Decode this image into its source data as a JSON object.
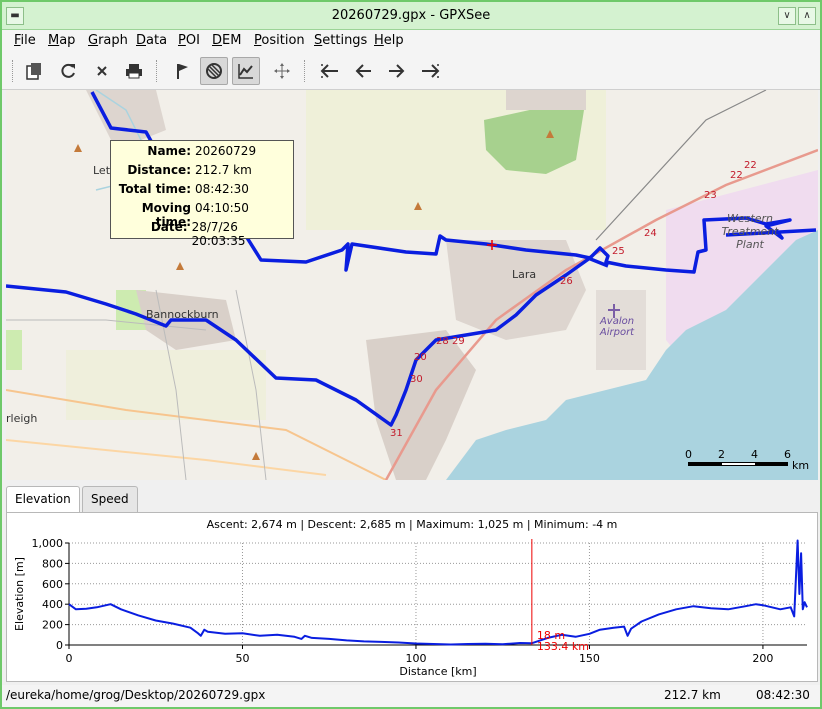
{
  "window": {
    "title": "20260729.gpx - GPXSee"
  },
  "menu": [
    {
      "label": "File",
      "u": "F",
      "rest": "ile"
    },
    {
      "label": "Map",
      "u": "M",
      "rest": "ap"
    },
    {
      "label": "Graph",
      "u": "G",
      "rest": "raph"
    },
    {
      "label": "Data",
      "u": "D",
      "rest": "ata"
    },
    {
      "label": "POI",
      "u": "P",
      "rest": "OI"
    },
    {
      "label": "DEM",
      "u": "D",
      "rest": "EM"
    },
    {
      "label": "Position",
      "u": "P",
      "rest": "osition"
    },
    {
      "label": "Settings",
      "u": "S",
      "rest": "ettings"
    },
    {
      "label": "Help",
      "u": "H",
      "rest": "elp"
    }
  ],
  "toolbar": {
    "icons": [
      "open-icon",
      "reload-icon",
      "close-icon",
      "print-icon",
      "flag-icon",
      "hide-map-icon",
      "graph-icon",
      "pan-icon",
      "first-icon",
      "previous-icon",
      "next-icon",
      "last-icon"
    ],
    "toggled": [
      "hide-map-icon",
      "graph-icon"
    ]
  },
  "track_info": {
    "rows": [
      {
        "key": "Name:",
        "value": "20260729"
      },
      {
        "key": "Distance:",
        "value": "212.7 km"
      },
      {
        "key": "Total time:",
        "value": "08:42:30"
      },
      {
        "key": "Moving time:",
        "value": "04:10:50"
      },
      {
        "key": "Date:",
        "value": "28/7/26 20:03:35"
      }
    ]
  },
  "map": {
    "places": [
      "Lara",
      "Bannockburn",
      "Avalon Airport",
      "Western Treatment Plant",
      "rleigh",
      "Let"
    ],
    "km_markers": [
      "20",
      "22",
      "22",
      "23",
      "24",
      "25",
      "26",
      "28",
      "29",
      "30",
      "31"
    ],
    "scale": {
      "ticks": [
        "0",
        "2",
        "4",
        "6"
      ],
      "unit": "km"
    },
    "colors": {
      "track": "#0a1ee0",
      "water": "#aad3df",
      "park": "#cdebb0",
      "urban": "#d9d0c9",
      "land": "#f2efe9"
    }
  },
  "tabs": [
    {
      "label": "Elevation",
      "active": true
    },
    {
      "label": "Speed",
      "active": false
    }
  ],
  "graph_summary": "Ascent: 2,674 m | Descent: 2,685 m | Maximum: 1,025 m | Minimum: -4 m",
  "chart_data": {
    "type": "line",
    "xlabel": "Distance [km]",
    "ylabel": "Elevation [m]",
    "xlim": [
      0,
      212.7
    ],
    "ylim": [
      0,
      1000
    ],
    "xticks": [
      0,
      50,
      100,
      150,
      200
    ],
    "yticks": [
      0,
      200,
      400,
      600,
      800,
      1000
    ],
    "ytick_labels": [
      "0",
      "200",
      "400",
      "600",
      "800",
      "1,000"
    ],
    "grid": true,
    "series": [
      {
        "color": "#0a1ee0",
        "x": [
          0,
          2,
          5,
          8,
          12,
          15,
          20,
          25,
          30,
          35,
          37,
          38,
          39,
          40,
          45,
          50,
          55,
          60,
          65,
          67,
          68,
          70,
          75,
          80,
          85,
          90,
          95,
          100,
          105,
          110,
          115,
          120,
          125,
          130,
          133.4,
          138,
          142,
          146,
          150,
          153,
          157,
          160,
          161,
          162,
          165,
          170,
          175,
          180,
          185,
          190,
          195,
          198,
          200,
          205,
          208,
          209,
          210,
          210.5,
          211,
          211.5,
          212,
          212.7
        ],
        "y": [
          400,
          350,
          355,
          370,
          400,
          350,
          290,
          240,
          210,
          170,
          120,
          90,
          150,
          130,
          110,
          115,
          90,
          100,
          80,
          60,
          90,
          70,
          60,
          45,
          35,
          30,
          25,
          15,
          10,
          5,
          10,
          12,
          8,
          20,
          18,
          70,
          100,
          80,
          110,
          150,
          170,
          180,
          90,
          160,
          230,
          300,
          350,
          380,
          360,
          350,
          380,
          400,
          390,
          350,
          370,
          280,
          1025,
          500,
          900,
          350,
          420,
          370
        ]
      }
    ],
    "cursor": {
      "x": 133.4,
      "label_elevation": "18 m",
      "label_distance": "133.4 km",
      "color": "#ee0000"
    }
  },
  "status": {
    "path": "/eureka/home/grog/Desktop/20260729.gpx",
    "distance": "212.7 km",
    "time": "08:42:30"
  }
}
